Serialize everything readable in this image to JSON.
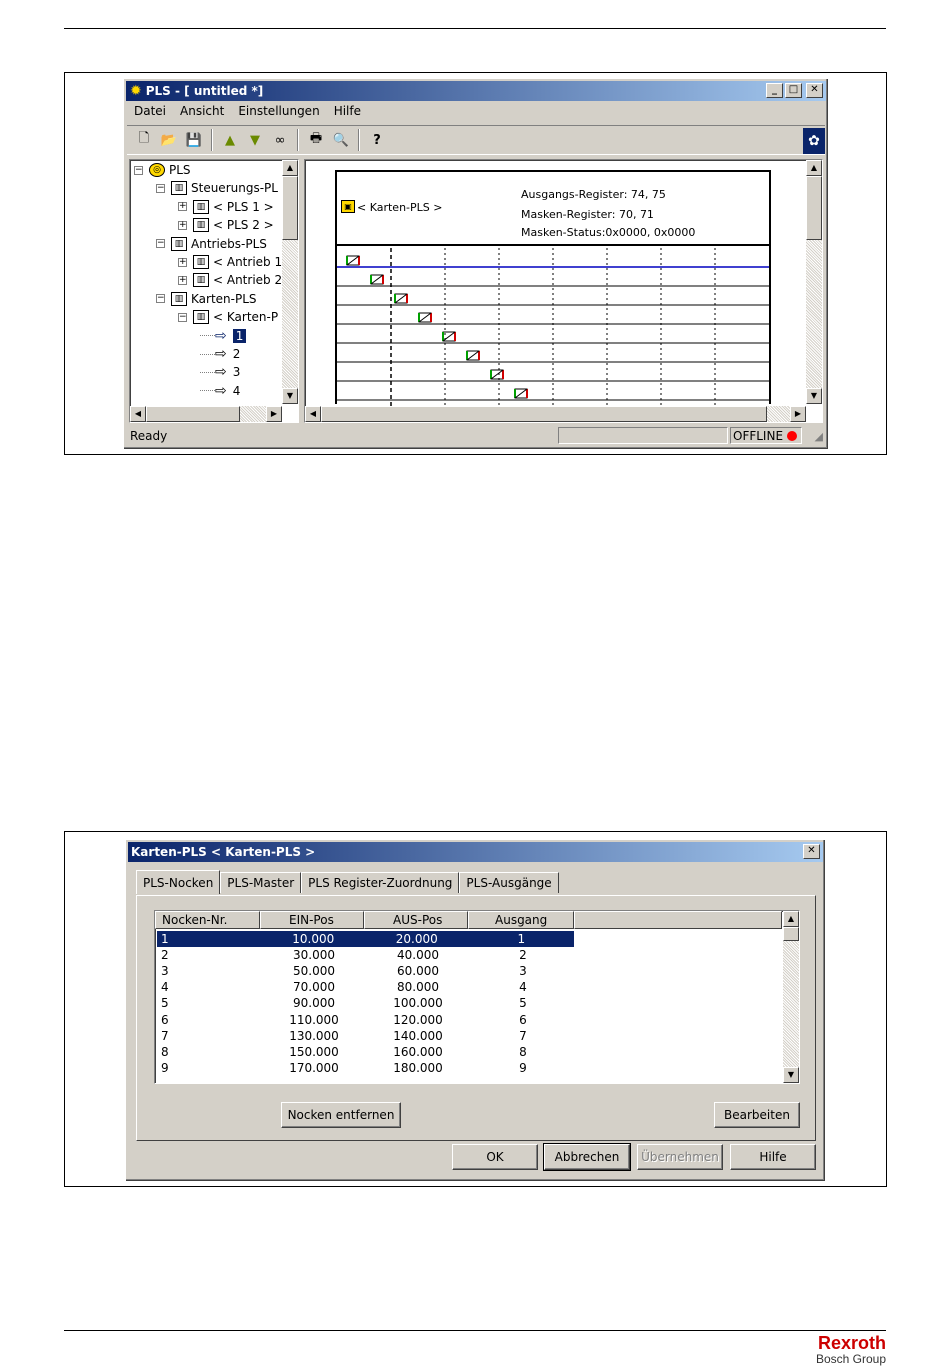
{
  "window": {
    "title": "PLS - [ untitled *]",
    "menu": [
      "Datei",
      "Ansicht",
      "Einstellungen",
      "Hilfe"
    ],
    "tree": [
      {
        "label": "PLS",
        "level": 0,
        "expander": "−"
      },
      {
        "label": "Steuerungs-PL",
        "level": 1,
        "expander": "−"
      },
      {
        "label": "< PLS 1 >",
        "level": 2,
        "expander": "+"
      },
      {
        "label": "< PLS 2 >",
        "level": 2,
        "expander": "+"
      },
      {
        "label": "Antriebs-PLS",
        "level": 1,
        "expander": "−"
      },
      {
        "label": "< Antrieb 1",
        "level": 2,
        "expander": "+"
      },
      {
        "label": "< Antrieb 2",
        "level": 2,
        "expander": "+"
      },
      {
        "label": "Karten-PLS",
        "level": 1,
        "expander": "−"
      },
      {
        "label": "< Karten-P",
        "level": 2,
        "expander": "−"
      },
      {
        "label": "1",
        "level": 3,
        "expander": ""
      },
      {
        "label": "2",
        "level": 3,
        "expander": ""
      },
      {
        "label": "3",
        "level": 3,
        "expander": ""
      },
      {
        "label": "4",
        "level": 3,
        "expander": ""
      }
    ],
    "diagram": {
      "label": "< Karten-PLS >",
      "info1": "Ausgangs-Register: 74, 75",
      "info2": "Masken-Register: 70, 71",
      "info3": "Masken-Status:0x0000, 0x0000"
    },
    "status": {
      "left": "Ready",
      "right": "OFFLINE"
    }
  },
  "dialog": {
    "title": "Karten-PLS < Karten-PLS >",
    "tabs": [
      "PLS-Nocken",
      "PLS-Master",
      "PLS Register-Zuordnung",
      "PLS-Ausgänge"
    ],
    "columns": [
      "Nocken-Nr.",
      "EIN-Pos",
      "AUS-Pos",
      "Ausgang"
    ],
    "rows": [
      [
        "1",
        "10.000",
        "20.000",
        "1"
      ],
      [
        "2",
        "30.000",
        "40.000",
        "2"
      ],
      [
        "3",
        "50.000",
        "60.000",
        "3"
      ],
      [
        "4",
        "70.000",
        "80.000",
        "4"
      ],
      [
        "5",
        "90.000",
        "100.000",
        "5"
      ],
      [
        "6",
        "110.000",
        "120.000",
        "6"
      ],
      [
        "7",
        "130.000",
        "140.000",
        "7"
      ],
      [
        "8",
        "150.000",
        "160.000",
        "8"
      ],
      [
        "9",
        "170.000",
        "180.000",
        "9"
      ]
    ],
    "buttons": {
      "remove": "Nocken entfernen",
      "edit": "Bearbeiten",
      "ok": "OK",
      "cancel": "Abbrechen",
      "apply": "Übernehmen",
      "help": "Hilfe"
    }
  },
  "footer": {
    "brand": "Rexroth",
    "group": "Bosch Group"
  },
  "colors": {
    "brand": "#cc0000",
    "selection": "#0a246a",
    "offline_dot": "#ff0000"
  }
}
